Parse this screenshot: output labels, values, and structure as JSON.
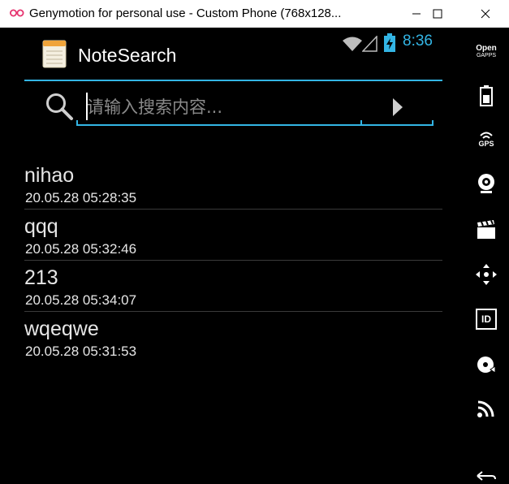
{
  "window": {
    "title": "Genymotion for personal use - Custom Phone (768x128..."
  },
  "status": {
    "time": "8:36",
    "accent_color": "#33b5e5"
  },
  "app": {
    "title": "NoteSearch"
  },
  "search": {
    "placeholder": "请输入搜索内容..."
  },
  "notes": [
    {
      "title": "nihao",
      "date": "20.05.28 05:28:35"
    },
    {
      "title": "qqq",
      "date": "20.05.28 05:32:46"
    },
    {
      "title": "213",
      "date": "20.05.28 05:34:07"
    },
    {
      "title": "wqeqwe",
      "date": "20.05.28 05:31:53"
    }
  ],
  "sidebar": {
    "opengapps_top": "Open",
    "opengapps_bottom": "GAPPS",
    "gps_label": "GPS",
    "id_label": "ID",
    "icons": [
      "opengapps-icon",
      "battery-icon",
      "gps-icon",
      "camera-icon",
      "clapperboard-icon",
      "dpad-icon",
      "id-icon",
      "disk-icon",
      "rss-icon",
      "back-icon"
    ]
  }
}
